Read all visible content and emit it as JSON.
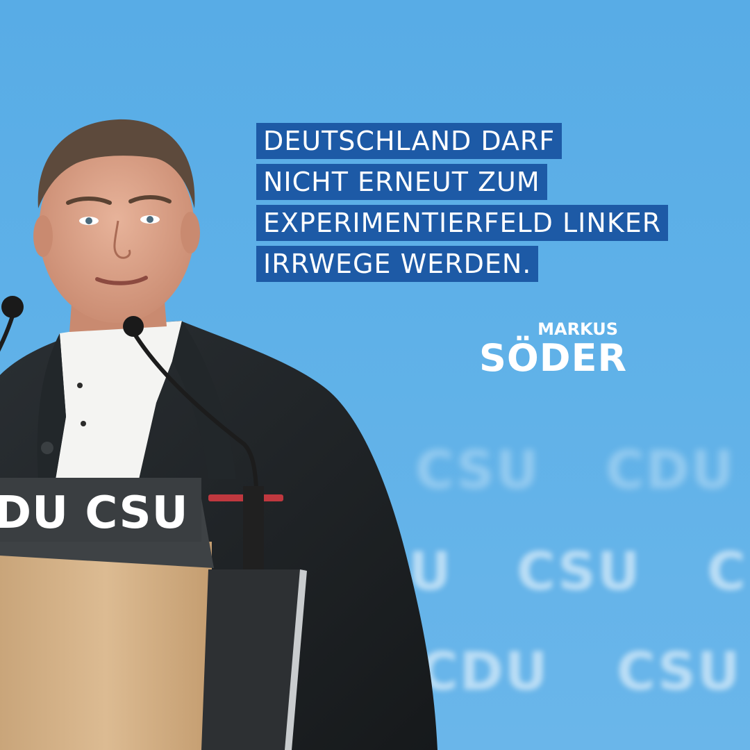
{
  "quote": {
    "lines": [
      "DEUTSCHLAND DARF",
      "NICHT ERNEUT ZUM",
      "EXPERIMENTIERFELD LINKER",
      "IRRWEGE WERDEN."
    ]
  },
  "signature": {
    "first_name": "MARKUS",
    "last_name": "SÖDER"
  },
  "backdrop": {
    "words": [
      "CSU",
      "CDU",
      "U",
      "CSU",
      "C",
      "CDU",
      "CSU"
    ]
  },
  "lectern": {
    "logo_text": "DU CSU"
  },
  "colors": {
    "background": "#5fb1e8",
    "quote_box": "#1d5aa6",
    "text": "#ffffff"
  }
}
